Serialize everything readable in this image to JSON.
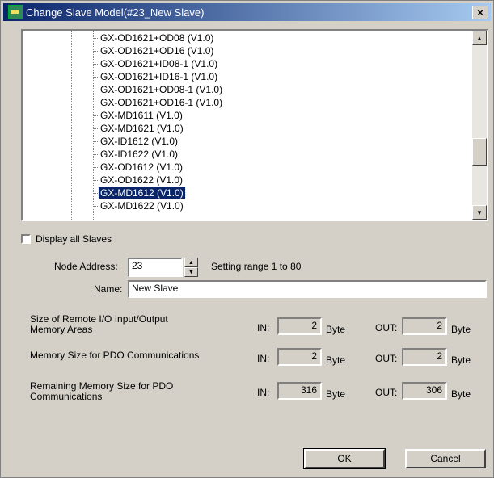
{
  "window": {
    "title": "Change Slave Model(#23_New Slave)",
    "close_label": "×"
  },
  "tree": {
    "items": [
      {
        "label": "GX-OD1621+OD08 (V1.0)",
        "selected": false
      },
      {
        "label": "GX-OD1621+OD16 (V1.0)",
        "selected": false
      },
      {
        "label": "GX-OD1621+ID08-1 (V1.0)",
        "selected": false
      },
      {
        "label": "GX-OD1621+ID16-1 (V1.0)",
        "selected": false
      },
      {
        "label": "GX-OD1621+OD08-1 (V1.0)",
        "selected": false
      },
      {
        "label": "GX-OD1621+OD16-1 (V1.0)",
        "selected": false
      },
      {
        "label": "GX-MD1611 (V1.0)",
        "selected": false
      },
      {
        "label": "GX-MD1621 (V1.0)",
        "selected": false
      },
      {
        "label": "GX-ID1612 (V1.0)",
        "selected": false
      },
      {
        "label": "GX-ID1622 (V1.0)",
        "selected": false
      },
      {
        "label": "GX-OD1612 (V1.0)",
        "selected": false
      },
      {
        "label": "GX-OD1622 (V1.0)",
        "selected": false
      },
      {
        "label": "GX-MD1612 (V1.0)",
        "selected": true
      },
      {
        "label": "GX-MD1622 (V1.0)",
        "selected": false
      }
    ],
    "scroll_up": "▲",
    "scroll_down": "▼"
  },
  "display_all": {
    "label": "Display all Slaves",
    "checked": false
  },
  "node_address": {
    "label": "Node Address:",
    "value": "23",
    "range_text": "Setting range 1 to 80",
    "spin_up": "▲",
    "spin_down": "▼"
  },
  "name_field": {
    "label": "Name:",
    "value": "New Slave"
  },
  "memory": {
    "in_label": "IN:",
    "out_label": "OUT:",
    "unit": "Byte",
    "rows": [
      {
        "label": "Size of Remote I/O Input/Output\nMemory Areas",
        "in": "2",
        "out": "2"
      },
      {
        "label": "Memory Size for PDO Communications",
        "in": "2",
        "out": "2"
      },
      {
        "label": "Remaining Memory Size for PDO\nCommunications",
        "in": "316",
        "out": "306"
      }
    ]
  },
  "buttons": {
    "ok": "OK",
    "cancel": "Cancel"
  },
  "colors": {
    "title_start": "#0a246a",
    "title_end": "#a6caf0",
    "selection": "#0a246a",
    "face": "#d4d0c8"
  }
}
